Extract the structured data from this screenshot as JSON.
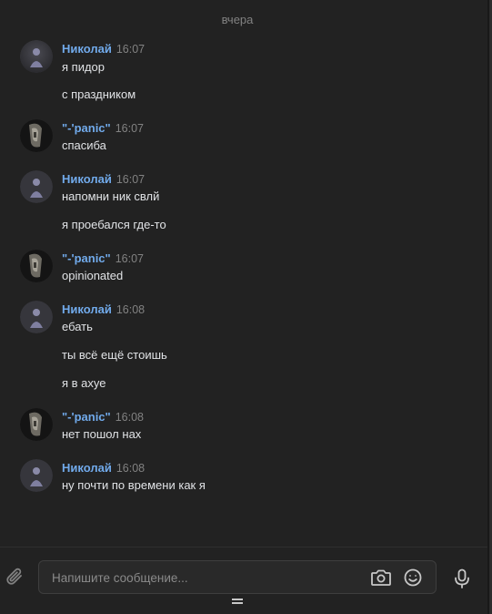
{
  "history": {
    "date_separator": "вчера"
  },
  "messages": [
    {
      "author": "Николай",
      "time": "16:07",
      "avatar": "nikolay-avatar",
      "texts": [
        "я пидор",
        "с праздником"
      ]
    },
    {
      "author": "\"-'panic\"",
      "time": "16:07",
      "avatar": "panic-avatar",
      "texts": [
        "спасиба"
      ]
    },
    {
      "author": "Николай",
      "time": "16:07",
      "avatar": "nikolay-avatar",
      "texts": [
        "напомни ник свлй",
        "я проебался где-то"
      ]
    },
    {
      "author": "\"-'panic\"",
      "time": "16:07",
      "avatar": "panic-avatar",
      "texts": [
        "opinionated"
      ]
    },
    {
      "author": "Николай",
      "time": "16:08",
      "avatar": "nikolay-avatar",
      "texts": [
        "ебать",
        "ты всё ещё стоишь",
        "я в ахуе"
      ]
    },
    {
      "author": "\"-'panic\"",
      "time": "16:08",
      "avatar": "panic-avatar",
      "texts": [
        "нет пошол нах"
      ]
    },
    {
      "author": "Николай",
      "time": "16:08",
      "avatar": "nikolay-avatar",
      "texts": [
        "ну почти по времени как я"
      ]
    }
  ],
  "composer": {
    "placeholder": "Напишите сообщение...",
    "value": "",
    "icons": {
      "attach": "paperclip-icon",
      "camera": "camera-icon",
      "emoji": "smile-icon",
      "voice": "microphone-icon"
    }
  },
  "colors": {
    "background": "#222222",
    "author_link": "#71aaeb",
    "text": "#e1e3e6",
    "muted": "#828282"
  }
}
